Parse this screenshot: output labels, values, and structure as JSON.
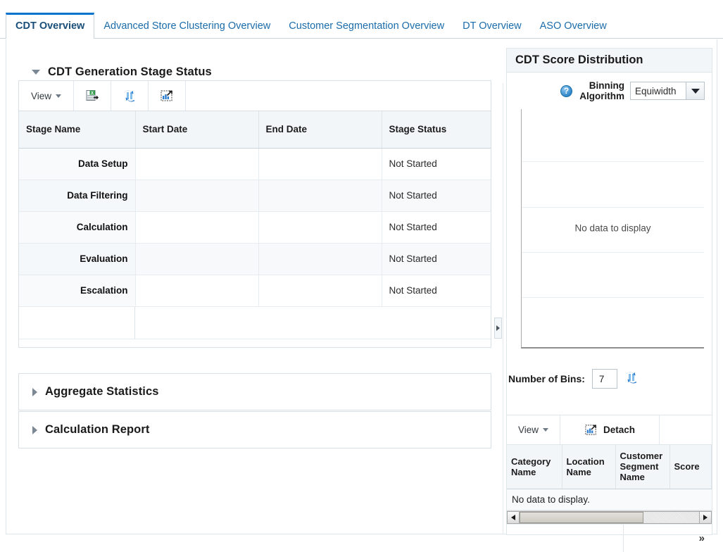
{
  "tabs": [
    {
      "label": "CDT Overview",
      "active": true
    },
    {
      "label": "Advanced Store Clustering Overview",
      "active": false
    },
    {
      "label": "Customer Segmentation Overview",
      "active": false
    },
    {
      "label": "DT Overview",
      "active": false
    },
    {
      "label": "ASO Overview",
      "active": false
    }
  ],
  "left": {
    "stage_section": {
      "title": "CDT Generation Stage Status",
      "toolbar": {
        "view_label": "View",
        "export_icon": "export-to-excel-icon",
        "refresh_icon": "refresh-query-icon",
        "detach_icon": "detach-icon"
      },
      "columns": [
        "Stage Name",
        "Start Date",
        "End Date",
        "Stage Status"
      ],
      "rows": [
        {
          "stage": "Data Setup",
          "start": "",
          "end": "",
          "status": "Not Started"
        },
        {
          "stage": "Data Filtering",
          "start": "",
          "end": "",
          "status": "Not Started"
        },
        {
          "stage": "Calculation",
          "start": "",
          "end": "",
          "status": "Not Started"
        },
        {
          "stage": "Evaluation",
          "start": "",
          "end": "",
          "status": "Not Started"
        },
        {
          "stage": "Escalation",
          "start": "",
          "end": "",
          "status": "Not Started"
        }
      ]
    },
    "aggregate_statistics": {
      "title": "Aggregate Statistics"
    },
    "calculation_report": {
      "title": "Calculation Report"
    }
  },
  "right": {
    "title": "CDT Score Distribution",
    "help_icon": "help-icon",
    "help_label": "?",
    "binning_label": "Binning Algorithm",
    "binning_value": "Equiwidth",
    "bins_label": "Number of Bins:",
    "bins_value": "7",
    "bins_refresh_icon": "refresh-query-icon",
    "table": {
      "view_label": "View",
      "detach_label": "Detach",
      "detach_icon": "detach-icon",
      "columns": [
        "Category Name",
        "Location Name",
        "Customer Segment Name",
        "Score"
      ],
      "empty_message": "No data to display.",
      "expand_label": "»"
    }
  },
  "chart_data": {
    "type": "bar",
    "title": "CDT Score Distribution",
    "categories": [],
    "values": [],
    "series": [],
    "xlabel": "",
    "ylabel": "",
    "grid": true,
    "gridlines": 4,
    "legend": "none",
    "empty_message": "No data to display"
  },
  "colors": {
    "accent": "#0572ce",
    "tab_link": "#1b6caa",
    "tab_active_text": "#1a4f7a",
    "header_bg": "#f2f6f9",
    "border": "#d8e0e6"
  }
}
